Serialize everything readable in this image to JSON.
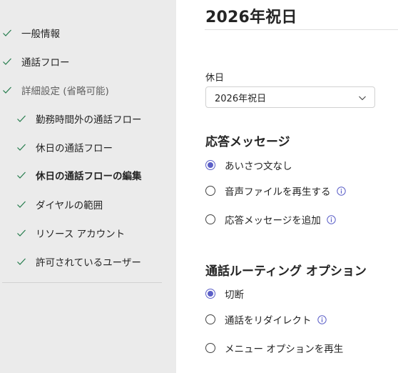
{
  "sidebar": {
    "items": [
      {
        "label": "一般情報"
      },
      {
        "label": "通話フロー"
      },
      {
        "label": "詳細設定 (省略可能)"
      },
      {
        "label": "勤務時間外の通話フロー"
      },
      {
        "label": "休日の通話フロー"
      },
      {
        "label": "休日の通話フローの編集"
      },
      {
        "label": "ダイヤルの範囲"
      },
      {
        "label": "リソース アカウント"
      },
      {
        "label": "許可されているユーザー"
      }
    ]
  },
  "main": {
    "title": "2026年祝日",
    "holiday_field": {
      "label": "休日",
      "value": "2026年祝日"
    },
    "greeting": {
      "heading": "応答メッセージ",
      "options": [
        {
          "label": "あいさつ文なし",
          "selected": true
        },
        {
          "label": "音声ファイルを再生する",
          "selected": false
        },
        {
          "label": "応答メッセージを追加",
          "selected": false
        }
      ]
    },
    "routing": {
      "heading": "通話ルーティング オプション",
      "options": [
        {
          "label": "切断",
          "selected": true
        },
        {
          "label": "通話をリダイレクト",
          "selected": false
        },
        {
          "label": "メニュー オプションを再生",
          "selected": false
        }
      ]
    }
  },
  "icons": {
    "check": "checkmark-icon",
    "chevron": "chevron-down-icon",
    "info": "info-icon"
  },
  "colors": {
    "accent": "#5b5fc7",
    "check": "#237b4b",
    "sidebar_bg": "#ebebeb"
  }
}
